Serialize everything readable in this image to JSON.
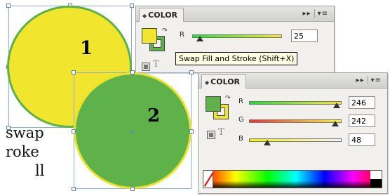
{
  "canvas": {
    "label_1": "1",
    "label_2": "2",
    "side_lines": [
      "swap",
      "roke",
      "ll"
    ]
  },
  "panel1": {
    "title": "COLOR",
    "channels": [
      {
        "label": "R",
        "value": "25",
        "level": 0.1
      }
    ],
    "fill_color": "#f2e52e",
    "stroke_color": "#5fb14a"
  },
  "tooltip": {
    "text": "Swap Fill and Stroke (Shift+X)"
  },
  "panel2": {
    "title": "COLOR",
    "channels": [
      {
        "label": "R",
        "value": "246",
        "level": 0.965
      },
      {
        "label": "G",
        "value": "242",
        "level": 0.95
      },
      {
        "label": "B",
        "value": "48",
        "level": 0.19
      }
    ],
    "fill_color": "#5fb14a",
    "stroke_color": "#f2e52e"
  },
  "icons": {
    "menu": "panel-menu-icon",
    "collapse": "double-arrow-icon"
  }
}
